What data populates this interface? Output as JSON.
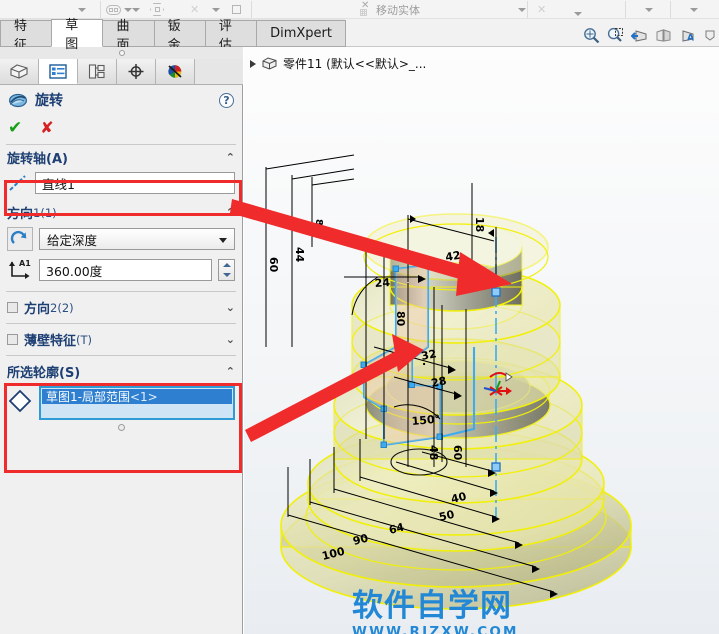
{
  "ribbon": {
    "move_body_label": "移动实体",
    "dropdown_caret": "caret-down",
    "icons": [
      "pill-icon",
      "hex-icon",
      "square-icon"
    ]
  },
  "command_tabs": [
    {
      "label": "特征",
      "active": false
    },
    {
      "label": "草图",
      "active": true
    },
    {
      "label": "曲面",
      "active": false
    },
    {
      "label": "钣金",
      "active": false
    },
    {
      "label": "评估",
      "active": false
    },
    {
      "label": "DimXpert",
      "active": false
    }
  ],
  "view_toolbar": [
    {
      "name": "zoom-to-fit-icon"
    },
    {
      "name": "zoom-to-area-icon"
    },
    {
      "name": "previous-view-icon"
    },
    {
      "name": "section-view-icon"
    },
    {
      "name": "view-orientation-icon"
    },
    {
      "name": "display-style-icon"
    }
  ],
  "manager_tabs": [
    {
      "name": "feature-manager-tab",
      "active": false
    },
    {
      "name": "property-manager-tab",
      "active": true
    },
    {
      "name": "configuration-manager-tab",
      "active": false
    },
    {
      "name": "dimxpert-manager-tab",
      "active": false
    },
    {
      "name": "display-manager-tab",
      "active": false
    }
  ],
  "property_manager": {
    "title": "旋转",
    "help_label": "?",
    "ok_label": "✔",
    "cancel_label": "✘",
    "sections": {
      "axis": {
        "header": "旋转轴(A)",
        "collapse": "⌃",
        "value": "直线1"
      },
      "direction1": {
        "header": "方向 ",
        "header_sub": "1(1)",
        "collapse": "⌃",
        "end_condition": "给定深度",
        "angle": "360.00度"
      },
      "direction2": {
        "header": "方向 ",
        "header_sub": "2(2)",
        "collapse": "⌄"
      },
      "thin_feature": {
        "header": "薄壁特征",
        "header_sub": "(T)",
        "collapse": "⌄"
      },
      "selected_contours": {
        "header": "所选轮廓(S)",
        "collapse": "⌃",
        "item": "草图1-局部范围",
        "item_suffix": "<1>"
      }
    }
  },
  "feature_tree": {
    "root": "零件11  (默认<<默认>_..."
  },
  "model_dimensions": [
    "42",
    "32",
    "28",
    "80",
    "60",
    "44",
    "8",
    "24",
    "18",
    "150°",
    "48",
    "60",
    "40",
    "50",
    "64",
    "90",
    "100"
  ],
  "watermark": {
    "cn": "软件自学网",
    "url": "WWW.RJZXW.COM"
  },
  "colors": {
    "accent_red": "#ef2b2b",
    "selection_blue": "#2e7fd0",
    "model_yellow": "#f2f000",
    "sketch_blue": "#3cabf0",
    "header_blue": "#1d3f73",
    "watermark_blue": "#2288d6"
  }
}
